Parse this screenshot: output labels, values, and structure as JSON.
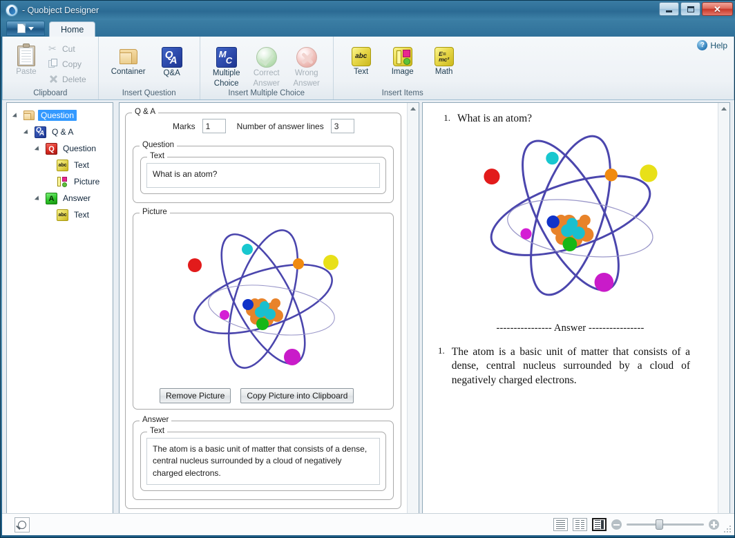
{
  "window": {
    "title": "- Quobject Designer",
    "app_icon": "quobject-logo-icon",
    "minimize": "minimize-icon",
    "maximize": "maximize-icon",
    "close": "✕"
  },
  "ribbon": {
    "app_button": "file-menu-icon",
    "tabs": [
      {
        "label": "Home",
        "active": true
      }
    ],
    "help": {
      "label": "Help",
      "icon": "help-circle-icon"
    },
    "groups": [
      {
        "name": "Clipboard",
        "label": "Clipboard",
        "big_buttons": [
          {
            "label": "Paste",
            "icon": "clipboard-icon",
            "enabled": false
          }
        ],
        "small_buttons": [
          {
            "label": "Cut",
            "icon": "scissors-icon",
            "enabled": false
          },
          {
            "label": "Copy",
            "icon": "copy-icon",
            "enabled": false
          },
          {
            "label": "Delete",
            "icon": "delete-x-icon",
            "enabled": false
          }
        ]
      },
      {
        "name": "Insert Question",
        "label": "Insert Question",
        "big_buttons": [
          {
            "label": "Container",
            "icon": "folder-icon",
            "enabled": true
          },
          {
            "label": "Q&A",
            "icon": "qa-icon",
            "enabled": true
          }
        ]
      },
      {
        "name": "Insert Multiple Choice",
        "label": "Insert Multiple Choice",
        "big_buttons": [
          {
            "label": "Multiple Choice",
            "line1": "Multiple",
            "line2": "Choice",
            "icon": "mc-icon",
            "enabled": true
          },
          {
            "label": "Correct Answer",
            "line1": "Correct",
            "line2": "Answer",
            "icon": "green-check-icon",
            "enabled": false
          },
          {
            "label": "Wrong Answer",
            "line1": "Wrong",
            "line2": "Answer",
            "icon": "red-cross-icon",
            "enabled": false
          }
        ]
      },
      {
        "name": "Insert Items",
        "label": "Insert Items",
        "big_buttons": [
          {
            "label": "Text",
            "icon": "abc-text-icon",
            "glyph": "abc",
            "enabled": true
          },
          {
            "label": "Image",
            "icon": "image-icon",
            "enabled": true
          },
          {
            "label": "Math",
            "icon": "math-icon",
            "glyph1": "E=",
            "glyph2": "mc²",
            "enabled": true
          }
        ]
      }
    ]
  },
  "tree": {
    "nodes": [
      {
        "label": "Question",
        "icon": "folder-icon",
        "depth": 0,
        "selected": true,
        "expanded": true
      },
      {
        "label": "Q & A",
        "icon": "qa-icon",
        "depth": 1,
        "selected": false,
        "expanded": true
      },
      {
        "label": "Question",
        "icon": "question-red-icon",
        "glyph": "Q",
        "depth": 2,
        "selected": false,
        "expanded": true
      },
      {
        "label": "Text",
        "icon": "abc-text-icon",
        "glyph": "abc",
        "depth": 3,
        "selected": false,
        "expanded": false
      },
      {
        "label": "Picture",
        "icon": "picture-icon",
        "depth": 3,
        "selected": false,
        "expanded": false
      },
      {
        "label": "Answer",
        "icon": "answer-green-icon",
        "glyph": "A",
        "depth": 2,
        "selected": false,
        "expanded": true
      },
      {
        "label": "Text",
        "icon": "abc-text-icon",
        "glyph": "abc",
        "depth": 3,
        "selected": false,
        "expanded": false
      }
    ]
  },
  "editor": {
    "qa_group_label": "Q & A",
    "marks_label": "Marks",
    "marks_value": "1",
    "answer_lines_label": "Number of answer lines",
    "answer_lines_value": "3",
    "question_group_label": "Question",
    "question_text_label": "Text",
    "question_text_value": "What is an atom?",
    "picture_group_label": "Picture",
    "picture_alt": "atom-diagram-image",
    "remove_picture_button": "Remove Picture",
    "copy_picture_button": "Copy Picture into Clipboard",
    "answer_group_label": "Answer",
    "answer_text_label": "Text",
    "answer_text_value": "The atom is a basic unit of matter that consists of a dense, central nucleus surrounded by a cloud of negatively charged electrons."
  },
  "preview": {
    "question_number": "1.",
    "question_text": "What is an atom?",
    "picture_alt": "atom-diagram-image",
    "answer_separator": "---------------- Answer ----------------",
    "answer_number": "1.",
    "answer_text": "The atom is a basic unit of matter that consists of a dense, central nucleus surrounded by a cloud of negatively charged electrons."
  },
  "statusbar": {
    "find_icon": "magnifier-icon",
    "view_modes": [
      {
        "name": "single-page-view",
        "icon": "single-page-icon",
        "active": false
      },
      {
        "name": "two-page-view",
        "icon": "two-page-icon",
        "active": false
      },
      {
        "name": "page-thumbnail-view",
        "icon": "page-thumbnail-icon",
        "active": true
      }
    ],
    "zoom_out_icon": "zoom-out-icon",
    "zoom_in_icon": "zoom-in-icon",
    "zoom_slider_position": "38"
  },
  "colors": {
    "title_bar": "#2e6f98",
    "selection_blue": "#3399ff",
    "ribbon_bg": "#eef2f6",
    "close_red": "#c8392a",
    "orbit_purple": "#4b46ad"
  }
}
